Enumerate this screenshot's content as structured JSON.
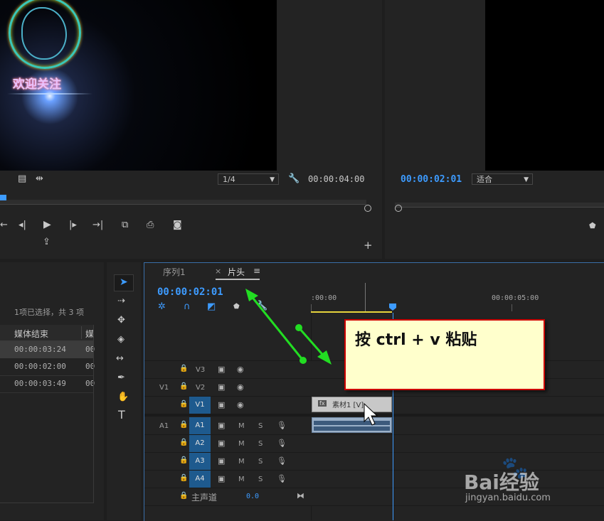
{
  "program_monitor": {
    "overlay_text": "欢迎关注",
    "resolution": "1/4",
    "duration": "00:00:04:00"
  },
  "source_monitor": {
    "timecode": "00:00:02:01",
    "fit": "适合"
  },
  "project": {
    "selection_info": "1项已选择，共 3 项",
    "column_media_end": "媒体结束",
    "column_next": "媒",
    "rows": [
      {
        "end": "00:00:03:24",
        "next": "00"
      },
      {
        "end": "00:00:02:00",
        "next": "00"
      },
      {
        "end": "00:00:03:49",
        "next": "00"
      }
    ]
  },
  "timeline": {
    "tab_sequence": "序列1",
    "tab_close": "×",
    "tab_active": "片头",
    "tab_menu": "≡",
    "timecode": "00:00:02:01",
    "ruler_start": ":00:00",
    "ruler_mark": "00:00:05:00",
    "tracks": {
      "v3": "V3",
      "v2": "V2",
      "v1": "V1",
      "v1_source": "V1",
      "a1": "A1",
      "a1_source": "A1",
      "a2": "A2",
      "a3": "A3",
      "a4": "A4",
      "mute": "M",
      "solo": "S",
      "master": "主声道",
      "master_value": "0.0"
    },
    "clip_label": "素材1 [V]",
    "fx_label": "fx"
  },
  "tools": {
    "type_tool": "T"
  },
  "callout": {
    "text": "按 ctrl + v 粘贴"
  },
  "watermark": {
    "brand": "Bai经验",
    "url": "jingyan.baidu.com"
  },
  "colors": {
    "accent_blue": "#3d9bff",
    "callout_bg": "#ffffcc",
    "callout_border": "#cc0000",
    "arrow_green": "#22dd22"
  }
}
